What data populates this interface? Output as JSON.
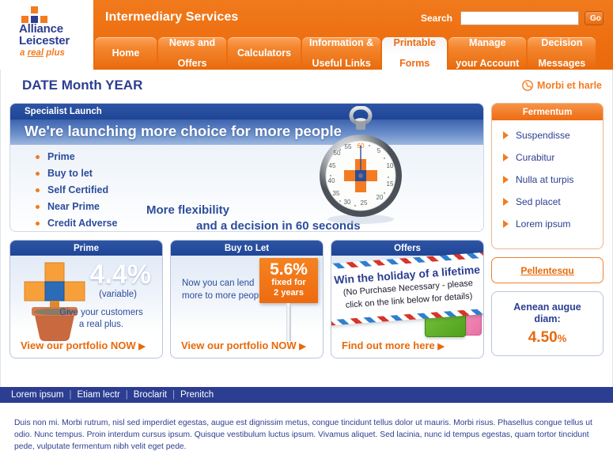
{
  "brand": {
    "logo_line1": "Alliance",
    "logo_line2": "Leicester",
    "tagline_a": "a ",
    "tagline_b": "real",
    "tagline_c": " plus"
  },
  "header": {
    "site_title": "Intermediary Services",
    "search_label": "Search",
    "search_value": "",
    "search_placeholder": "",
    "go_label": "Go",
    "accent_color": "#EE6B10",
    "navy_color": "#2C3E91"
  },
  "nav": {
    "tabs": [
      {
        "label": "Home",
        "line2": "",
        "active": false
      },
      {
        "label": "News and",
        "line2": "Offers",
        "active": false
      },
      {
        "label": "Calculators",
        "line2": "",
        "active": false
      },
      {
        "label": "Information &",
        "line2": "Useful Links",
        "active": false
      },
      {
        "label": "Printable",
        "line2": "Forms",
        "active": true
      },
      {
        "label": "Manage",
        "line2": "your Account",
        "active": false
      },
      {
        "label": "Decision",
        "line2": "Messages",
        "active": false
      }
    ]
  },
  "datebar": {
    "date_title": "DATE Month YEAR",
    "phone_text": "Morbi et harle"
  },
  "hero": {
    "eyebrow": "Specialist Launch",
    "headline": "We're launching more choice for more people",
    "bullets": [
      "Prime",
      "Buy to let",
      "Self Certified",
      "Near Prime",
      "Credit Adverse"
    ],
    "tagline_line1": "More flexibility",
    "tagline_line2": "and a decision in 60 seconds",
    "stopwatch_ticks": [
      "60",
      "5",
      "10",
      "15",
      "20",
      "25",
      "30",
      "35",
      "40",
      "45",
      "50",
      "55"
    ]
  },
  "promos": [
    {
      "title": "Prime",
      "rate": "4.4%",
      "rate_note": "(variable)",
      "copy_line1": "Give your customers",
      "copy_line2": "a real plus.",
      "cta": "View our portfolio NOW"
    },
    {
      "title": "Buy to Let",
      "copy_line1": "Now you can lend",
      "copy_line2": "more to more people.",
      "sign_rate": "5.6%",
      "sign_line1": "fixed for",
      "sign_line2": "2 years",
      "cta": "View our portfolio NOW"
    },
    {
      "title": "Offers",
      "env_line1": "Win the holiday of a lifetime",
      "env_line2": "(No Purchase Necessary - please",
      "env_line3": "click on the link below for details)",
      "cta": "Find out more here"
    }
  ],
  "sidebar": {
    "panel_title": "Fermentum",
    "items": [
      {
        "label": "Suspendisse"
      },
      {
        "label": "Curabitur"
      },
      {
        "label": "Nulla at turpis"
      },
      {
        "label": "Sed placet"
      },
      {
        "label": "Lorem ipsum"
      }
    ],
    "button_label": "Pellentesqu",
    "rate_card": {
      "title_line1": "Aenean augue",
      "title_line2": "diam:",
      "value": "4.50",
      "value_unit": "%"
    }
  },
  "footer": {
    "links": [
      "Lorem ipsum",
      "Etiam lectr",
      "Broclarit",
      "Prenitch"
    ],
    "separator": "|",
    "legal": "Duis non mi. Morbi rutrum, nisl sed imperdiet egestas, augue est dignissim metus, congue tincidunt tellus dolor ut mauris. Morbi risus. Phasellus congue tellus ut odio. Nunc tempus. Proin interdum cursus ipsum. Quisque vestibulum luctus ipsum. Vivamus aliquet. Sed lacinia, nunc id tempus egestas, quam tortor tincidunt pede, vulputate fermentum nibh velit eget pede."
  }
}
